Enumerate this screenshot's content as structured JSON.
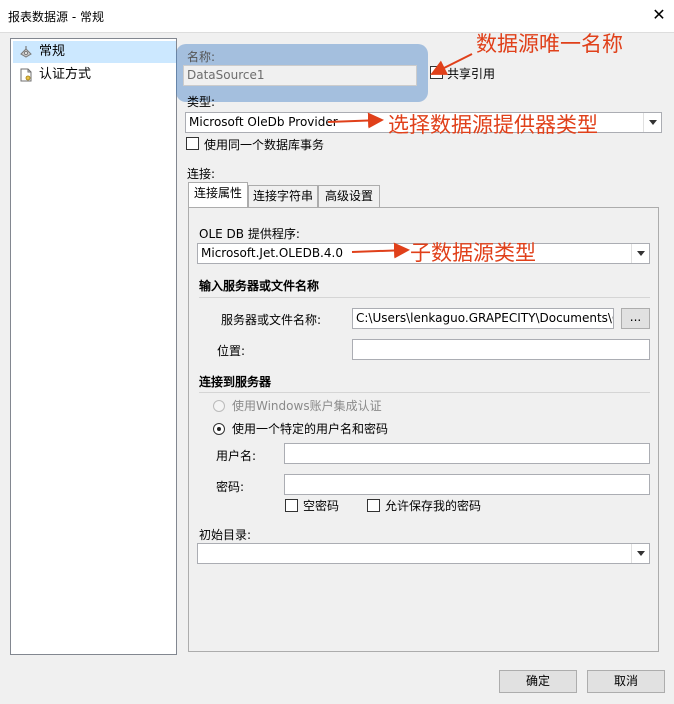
{
  "window": {
    "title": "报表数据源 - 常规",
    "close_glyph": "✕"
  },
  "sidebar": {
    "items": [
      {
        "label": "常规",
        "icon": "general-settings-icon",
        "selected": true
      },
      {
        "label": "认证方式",
        "icon": "document-icon",
        "selected": false
      }
    ]
  },
  "general": {
    "name_label": "名称:",
    "name_value": "DataSource1",
    "shared_ref_label": "共享引用",
    "type_label": "类型:",
    "type_value": "Microsoft OleDb Provider",
    "same_transaction_label": "使用同一个数据库事务",
    "connection_label": "连接:"
  },
  "tabs": [
    {
      "label": "连接属性",
      "active": true
    },
    {
      "label": "连接字符串"
    },
    {
      "label": "高级设置"
    }
  ],
  "connection": {
    "provider_label": "OLE DB 提供程序:",
    "provider_value": "Microsoft.Jet.OLEDB.4.0",
    "server_section": "输入服务器或文件名称",
    "server_label": "服务器或文件名称:",
    "server_value": "C:\\Users\\lenkaguo.GRAPECITY\\Documents\\Gra",
    "browse_label": "...",
    "location_label": "位置:",
    "location_value": "",
    "login_section": "连接到服务器",
    "windows_auth_label": "使用Windows账户集成认证",
    "specific_user_label": "使用一个特定的用户名和密码",
    "username_label": "用户名:",
    "username_value": "",
    "password_label": "密码:",
    "password_value": "",
    "blank_password_label": "空密码",
    "save_password_label": "允许保存我的密码",
    "initial_catalog_label": "初始目录:",
    "initial_catalog_value": ""
  },
  "buttons": {
    "ok": "确定",
    "cancel": "取消"
  },
  "annotations": {
    "name": "数据源唯一名称",
    "type": "选择数据源提供器类型",
    "subtype": "子数据源类型",
    "color": "#e0401a",
    "highlight_color": "#4682c8"
  }
}
